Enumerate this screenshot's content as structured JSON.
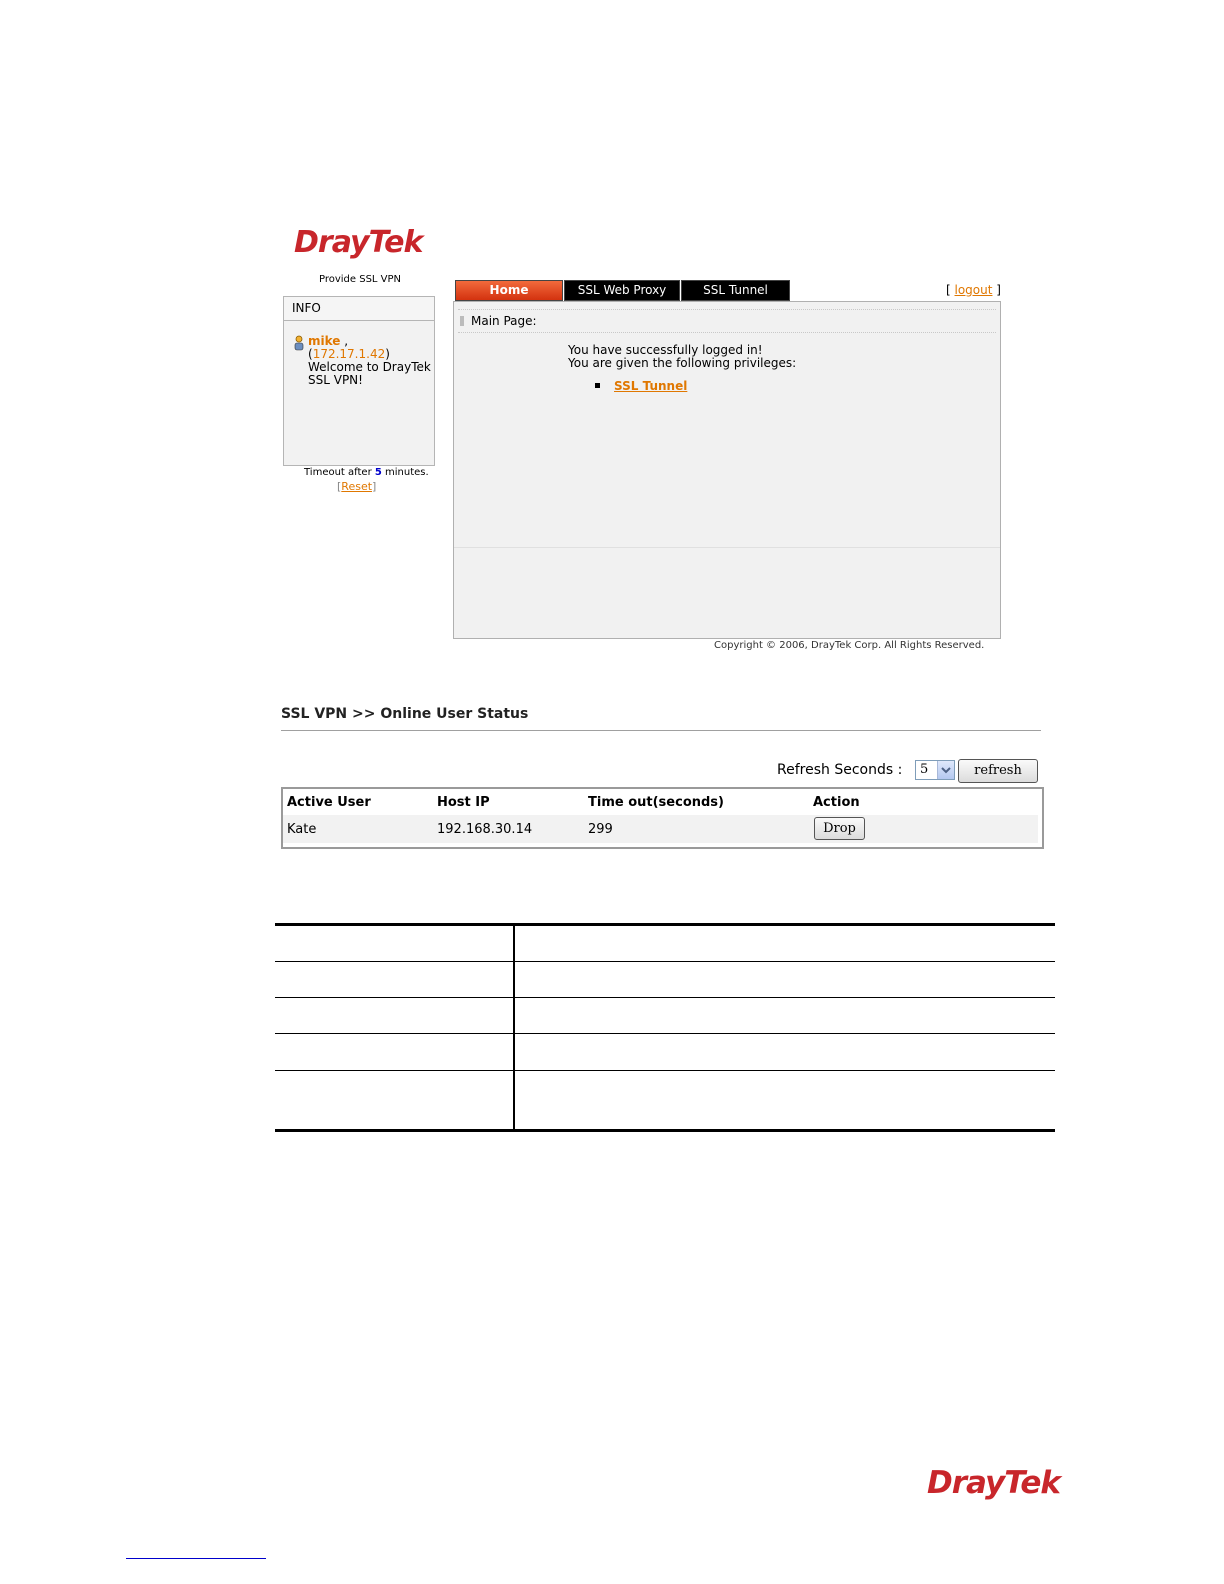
{
  "portal": {
    "logo": {
      "dray": "Dray",
      "tek": "Tek"
    },
    "tagline": "Provide SSL VPN",
    "info": {
      "header": "INFO",
      "username": "mike",
      "username_suffix": " ,",
      "ip_open": "(",
      "ip": "172.17.1.42",
      "ip_close": ")",
      "welcome_line1": "Welcome to DrayTek",
      "welcome_line2": "SSL VPN!"
    },
    "timeout": {
      "prefix": "Timeout after ",
      "value": "5",
      "suffix": " minutes."
    },
    "reset": {
      "open": "[",
      "label": "Reset",
      "close": "]"
    },
    "tabs": [
      {
        "label": "Home",
        "active": true
      },
      {
        "label": "SSL Web Proxy",
        "active": false
      },
      {
        "label": "SSL Tunnel",
        "active": false
      }
    ],
    "logout": {
      "open": "[ ",
      "label": "logout",
      "close": " ]"
    },
    "main": {
      "section_title": "Main Page:",
      "line1": "You have successfully logged in!",
      "line2": "You are given the following privileges:",
      "privileges": [
        "SSL Tunnel"
      ]
    },
    "copyright": "Copyright © 2006, DrayTek Corp. All Rights Reserved."
  },
  "status": {
    "title": "SSL VPN >> Online User Status",
    "refresh_label": "Refresh Seconds :",
    "refresh_value": "5",
    "refresh_button": "refresh",
    "columns": [
      "Active User",
      "Host IP",
      "Time out(seconds)",
      "Action"
    ],
    "rows": [
      {
        "user": "Kate",
        "host_ip": "192.168.30.14",
        "timeout": "299",
        "action": "Drop"
      }
    ]
  },
  "footer": {
    "logo": {
      "dray": "Dray",
      "tek": "Tek"
    }
  },
  "colors": {
    "brand_red": "#c8262b",
    "accent_orange": "#e07700",
    "tab_active": "#e8431c"
  }
}
